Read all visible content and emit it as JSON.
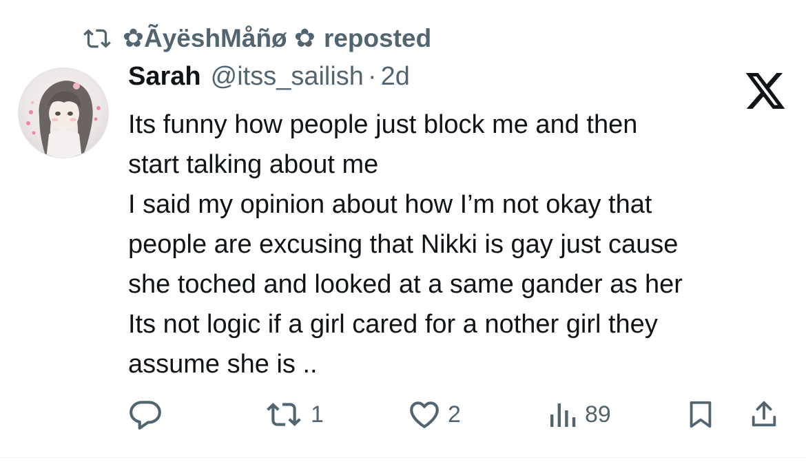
{
  "repost": {
    "user": "✿ÃyëshMåñø ✿",
    "label": "reposted"
  },
  "tweet": {
    "author_name": "Sarah",
    "author_handle": "@itss_sailish",
    "separator": "·",
    "time": "2d",
    "lines": [
      "Its funny how people just block me and then",
      "start talking about me",
      "I said my opinion about how I’m not okay that",
      "people are excusing that Nikki is gay just cause",
      "she toched and looked at a same gander as her",
      "Its not logic if a girl cared for a nother girl they",
      "assume she is .."
    ]
  },
  "actions": {
    "reply_count": "",
    "repost_count": "1",
    "like_count": "2",
    "views_count": "89"
  },
  "icons": {
    "repost": "repost-icon",
    "avatar": "avatar-image",
    "platform": "x-logo-icon",
    "reply": "reply-icon",
    "like": "heart-icon",
    "views": "views-icon",
    "bookmark": "bookmark-icon",
    "share": "share-icon"
  },
  "colors": {
    "text_primary": "#0f1419",
    "text_secondary": "#536471",
    "background": "#ffffff"
  }
}
